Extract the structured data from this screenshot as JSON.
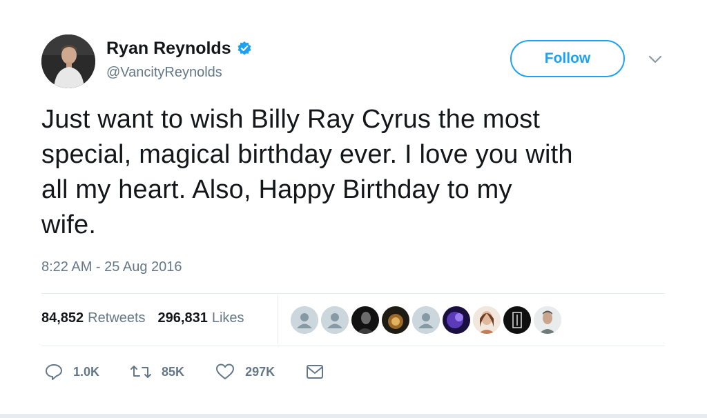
{
  "author": {
    "name": "Ryan Reynolds",
    "handle": "@VancityReynolds",
    "verified": true
  },
  "follow_label": "Follow",
  "tweet": {
    "line1": "Just want to wish Billy Ray Cyrus the most",
    "line2": "special, magical birthday ever. I love you with",
    "line3": "all my heart. Also, Happy Birthday to my",
    "line4": "wife.",
    "timestamp": "8:22 AM - 25 Aug 2016"
  },
  "stats": {
    "retweets_count": "84,852",
    "retweets_label": "Retweets",
    "likes_count": "296,831",
    "likes_label": "Likes"
  },
  "likers": [
    {
      "icon": "default-avatar-icon"
    },
    {
      "icon": "default-avatar-icon"
    },
    {
      "icon": "user-avatar"
    },
    {
      "icon": "user-avatar"
    },
    {
      "icon": "default-avatar-icon"
    },
    {
      "icon": "user-avatar"
    },
    {
      "icon": "user-avatar"
    },
    {
      "icon": "user-avatar"
    },
    {
      "icon": "user-avatar"
    }
  ],
  "actions": {
    "reply_count": "1.0K",
    "retweet_count": "85K",
    "like_count": "297K"
  },
  "colors": {
    "accent": "#1da1f2",
    "text": "#14171a",
    "muted": "#657786",
    "divider": "#e6ecf0"
  }
}
